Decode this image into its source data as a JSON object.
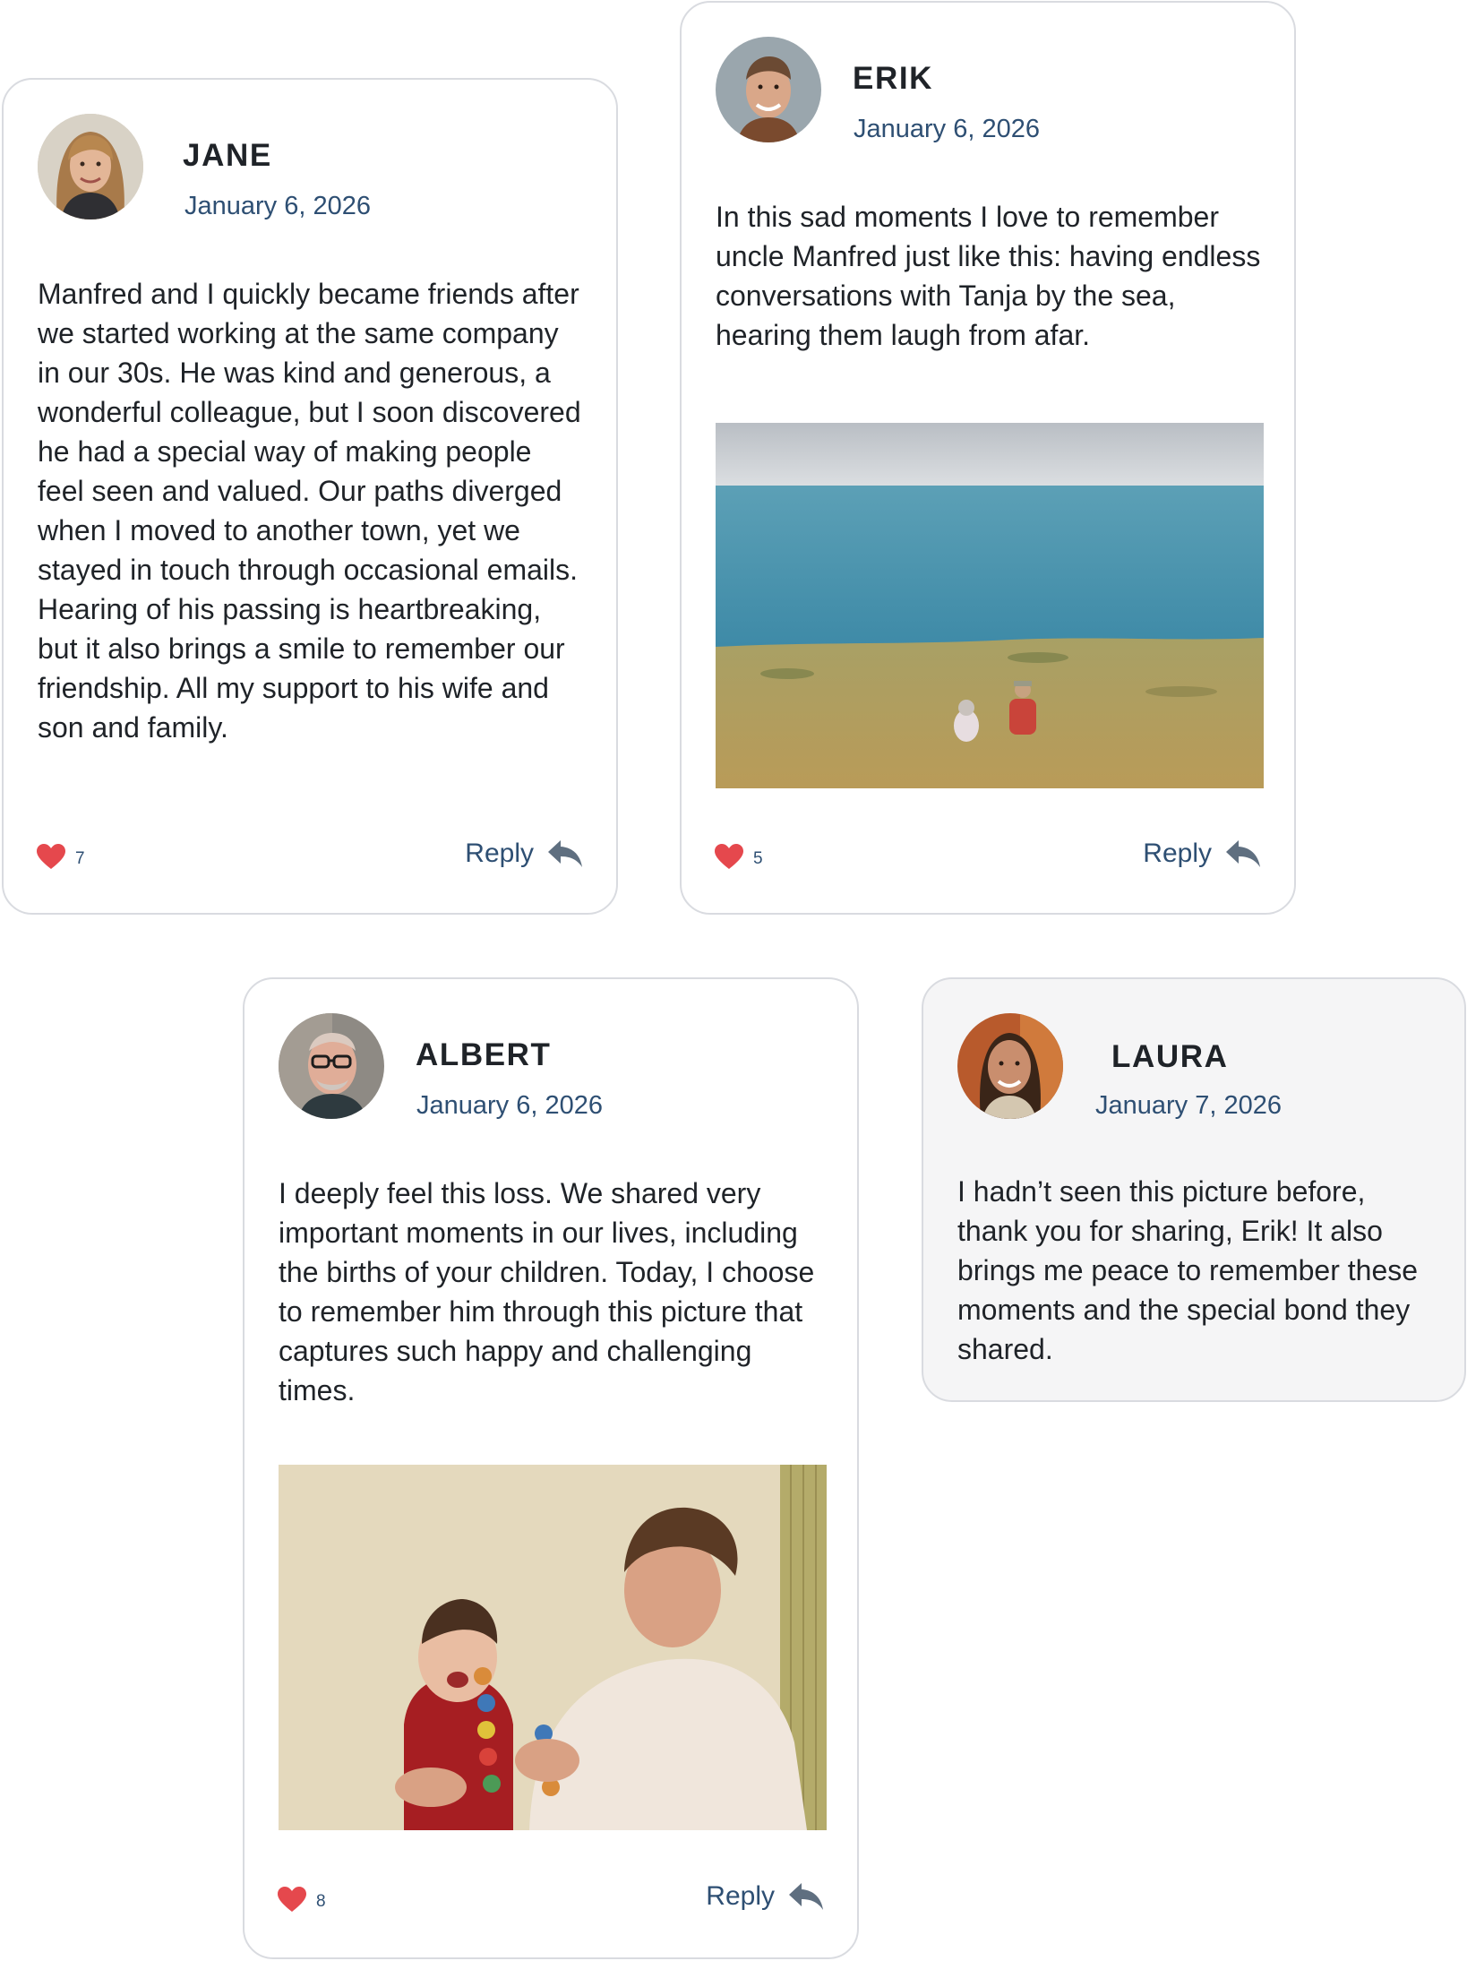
{
  "comments": [
    {
      "name": "JANE",
      "date": "January 6, 2026",
      "text": "Manfred and I quickly became friends after we started working at the same company in our 30s. He was kind and generous, a wonderful colleague, but I soon discovered he had a special way of making people feel seen and valued. Our paths diverged when I moved to another town, yet we stayed in touch through occasional emails. Hearing of his passing is heartbreaking, but it also brings a smile to remember our friendship. All my support to his wife and son and family.",
      "likes": "7",
      "reply_label": "Reply"
    },
    {
      "name": "ERIK",
      "date": "January 6, 2026",
      "text": "In this sad moments I love to remember uncle Manfred just like this: having endless conversations with Tanja by the sea, hearing them laugh from afar.",
      "likes": "5",
      "reply_label": "Reply"
    },
    {
      "name": "ALBERT",
      "date": "January 6, 2026",
      "text": "I deeply feel this loss. We shared very important moments in our lives, including the births of your children. Today, I choose to remember him through this picture that captures such happy and challenging times.",
      "likes": "8",
      "reply_label": "Reply"
    },
    {
      "name": "LAURA",
      "date": "January 7, 2026",
      "text": "I hadn’t seen this picture before, thank you for sharing, Erik! It also brings me peace to remember these moments and the special bond they shared."
    }
  ],
  "icons": {
    "like": "heart-icon",
    "reply": "reply-arrow-icon"
  },
  "colors": {
    "heart": "#e5484d",
    "accent_text": "#2e4f73",
    "card_border": "#d9dbe0",
    "highlighted_card_bg": "#f5f5f6"
  }
}
